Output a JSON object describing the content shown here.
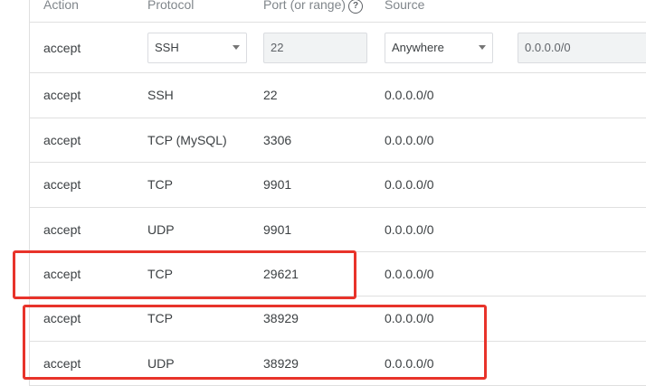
{
  "header": {
    "action": "Action",
    "protocol": "Protocol",
    "port": "Port (or range)",
    "help_icon_glyph": "?",
    "source": "Source"
  },
  "edit_row": {
    "action": "accept",
    "protocol_value": "SSH",
    "port_value": "22",
    "source_value": "Anywhere",
    "cidr_value": "0.0.0.0/0"
  },
  "rules": [
    {
      "action": "accept",
      "protocol": "SSH",
      "port": "22",
      "source": "0.0.0.0/0"
    },
    {
      "action": "accept",
      "protocol": "TCP (MySQL)",
      "port": "3306",
      "source": "0.0.0.0/0"
    },
    {
      "action": "accept",
      "protocol": "TCP",
      "port": "9901",
      "source": "0.0.0.0/0"
    },
    {
      "action": "accept",
      "protocol": "UDP",
      "port": "9901",
      "source": "0.0.0.0/0"
    },
    {
      "action": "accept",
      "protocol": "TCP",
      "port": "29621",
      "source": "0.0.0.0/0"
    },
    {
      "action": "accept",
      "protocol": "TCP",
      "port": "38929",
      "source": "0.0.0.0/0"
    },
    {
      "action": "accept",
      "protocol": "UDP",
      "port": "38929",
      "source": "0.0.0.0/0"
    }
  ],
  "colors": {
    "highlight": "#e8332a",
    "border": "#e0e0e0",
    "text": "#3c4043",
    "header_text": "#80868b",
    "disabled_bg": "#f1f3f4"
  }
}
